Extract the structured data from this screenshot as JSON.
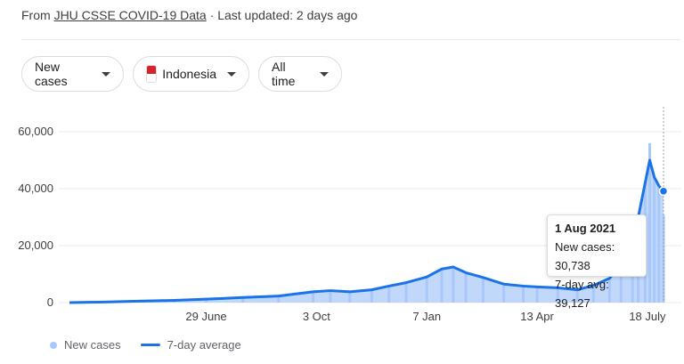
{
  "source": {
    "prefix": "From",
    "link_text": "JHU CSSE COVID-19 Data",
    "separator": "·",
    "updated": "Last updated: 2 days ago"
  },
  "filters": {
    "metric": "New cases",
    "country": "Indonesia",
    "range": "All time"
  },
  "tooltip": {
    "date": "1 Aug 2021",
    "new_cases_label": "New cases: 30,738",
    "avg_label": "7-day avg: 39,127"
  },
  "legend": {
    "bars": "New cases",
    "line": "7-day average"
  },
  "colors": {
    "bars": "#a8c7fa",
    "line": "#1a73e8",
    "grid": "#ebebeb"
  },
  "chart_data": {
    "type": "bar",
    "title": "",
    "xlabel": "",
    "ylabel": "",
    "ylim": [
      0,
      60000
    ],
    "y_ticks": [
      "60,000",
      "40,000",
      "20,000",
      "0"
    ],
    "y_tick_values": [
      60000,
      40000,
      20000,
      0
    ],
    "x_ticks": [
      "29 June",
      "3 Oct",
      "7 Jan",
      "13 Apr",
      "18 July"
    ],
    "x_tick_dates": [
      "2020-06-29",
      "2020-10-03",
      "2021-01-07",
      "2021-04-13",
      "2021-07-18"
    ],
    "x_range": [
      "2020-03-02",
      "2021-08-01"
    ],
    "series": [
      {
        "name": "7-day average",
        "style": "line",
        "x": [
          "2020-03-02",
          "2020-04-01",
          "2020-05-01",
          "2020-06-01",
          "2020-06-29",
          "2020-07-31",
          "2020-08-31",
          "2020-09-30",
          "2020-10-15",
          "2020-11-01",
          "2020-11-20",
          "2020-12-05",
          "2020-12-20",
          "2021-01-07",
          "2021-01-20",
          "2021-01-30",
          "2021-02-10",
          "2021-02-25",
          "2021-03-15",
          "2021-04-01",
          "2021-04-13",
          "2021-05-01",
          "2021-05-18",
          "2021-06-01",
          "2021-06-15",
          "2021-06-25",
          "2021-07-05",
          "2021-07-10",
          "2021-07-16",
          "2021-07-20",
          "2021-07-24",
          "2021-07-28",
          "2021-08-01"
        ],
        "values": [
          0,
          200,
          500,
          800,
          1200,
          1800,
          2300,
          3800,
          4200,
          3800,
          4500,
          5800,
          7000,
          9000,
          11800,
          12500,
          10500,
          8800,
          6500,
          5800,
          5500,
          5200,
          4500,
          6000,
          8500,
          13500,
          20000,
          30000,
          42000,
          50000,
          44000,
          41000,
          39127
        ]
      },
      {
        "name": "New cases",
        "style": "bar",
        "x": [
          "2020-03-02",
          "2020-04-01",
          "2020-05-01",
          "2020-06-01",
          "2020-06-29",
          "2020-07-31",
          "2020-08-31",
          "2020-09-30",
          "2020-10-15",
          "2020-11-01",
          "2020-11-20",
          "2020-12-05",
          "2020-12-20",
          "2021-01-07",
          "2021-01-20",
          "2021-01-30",
          "2021-02-10",
          "2021-02-25",
          "2021-03-15",
          "2021-04-01",
          "2021-04-13",
          "2021-05-01",
          "2021-05-18",
          "2021-06-01",
          "2021-06-15",
          "2021-06-25",
          "2021-07-05",
          "2021-07-10",
          "2021-07-16",
          "2021-07-20",
          "2021-07-24",
          "2021-07-28",
          "2021-08-01"
        ],
        "values": [
          0,
          200,
          500,
          800,
          1200,
          1800,
          2300,
          3800,
          4200,
          3800,
          4500,
          5800,
          7000,
          9000,
          11800,
          12500,
          10500,
          8800,
          6500,
          5800,
          5500,
          5200,
          4500,
          6000,
          8500,
          13500,
          20000,
          30000,
          42000,
          56000,
          44000,
          41000,
          30738
        ]
      }
    ],
    "grid": true,
    "legend_position": "bottom-left",
    "highlight_date": "2021-08-01"
  }
}
